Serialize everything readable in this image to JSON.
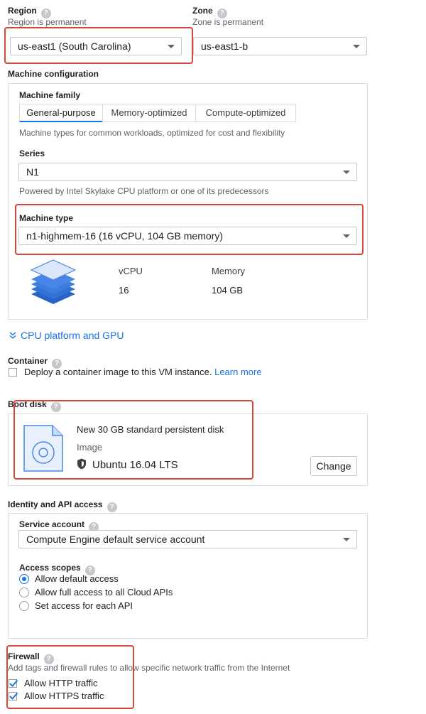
{
  "region": {
    "label": "Region",
    "help": "?",
    "hint": "Region is permanent",
    "value": "us-east1 (South Carolina)"
  },
  "zone": {
    "label": "Zone",
    "help": "?",
    "hint": "Zone is permanent",
    "value": "us-east1-b"
  },
  "machine_configuration": {
    "heading": "Machine configuration",
    "family_label": "Machine family",
    "tabs": [
      "General-purpose",
      "Memory-optimized",
      "Compute-optimized"
    ],
    "active_tab": "General-purpose",
    "family_desc": "Machine types for common workloads, optimized for cost and flexibility",
    "series_label": "Series",
    "series_value": "N1",
    "series_desc": "Powered by Intel Skylake CPU platform or one of its predecessors",
    "type_label": "Machine type",
    "type_value": "n1-highmem-16 (16 vCPU, 104 GB memory)",
    "vcpu_label": "vCPU",
    "vcpu_value": "16",
    "memory_label": "Memory",
    "memory_value": "104 GB"
  },
  "cpu_platform": {
    "label": "CPU platform and GPU",
    "icon": "chevron-double-down-icon"
  },
  "container": {
    "label": "Container",
    "help": "?",
    "checkbox_label": "Deploy a container image to this VM instance.",
    "learn_more": "Learn more",
    "checked": false
  },
  "boot_disk": {
    "label": "Boot disk",
    "help": "?",
    "title": "New 30 GB standard persistent disk",
    "image_label": "Image",
    "image_value": "Ubuntu 16.04 LTS",
    "change_button": "Change"
  },
  "identity": {
    "heading": "Identity and API access",
    "help": "?",
    "service_account_label": "Service account",
    "service_account_value": "Compute Engine default service account",
    "access_scopes_label": "Access scopes",
    "scopes": [
      {
        "label": "Allow default access",
        "selected": true
      },
      {
        "label": "Allow full access to all Cloud APIs",
        "selected": false
      },
      {
        "label": "Set access for each API",
        "selected": false
      }
    ]
  },
  "firewall": {
    "label": "Firewall",
    "help": "?",
    "desc": "Add tags and firewall rules to allow specific network traffic from the Internet",
    "options": [
      {
        "label": "Allow HTTP traffic",
        "checked": true
      },
      {
        "label": "Allow HTTPS traffic",
        "checked": true
      }
    ]
  },
  "colors": {
    "accent": "#1a73e8",
    "highlight": "#d9453b",
    "border": "#dadce0",
    "stack_icon": "#4a86e8"
  }
}
